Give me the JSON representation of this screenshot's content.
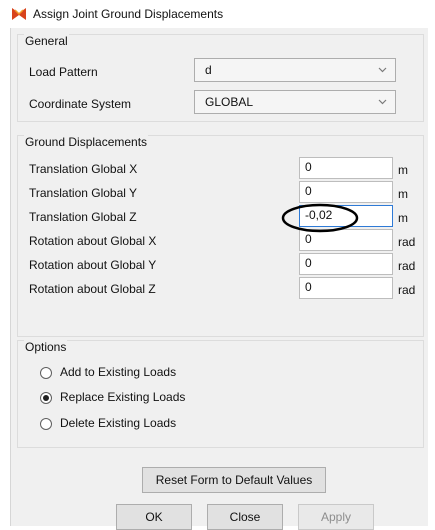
{
  "window": {
    "title": "Assign Joint Ground Displacements",
    "icon": "app-logo-icon"
  },
  "general": {
    "title": "General",
    "load_pattern": {
      "label": "Load Pattern",
      "value": "d"
    },
    "coordinate_system": {
      "label": "Coordinate System",
      "value": "GLOBAL"
    }
  },
  "ground_displacements": {
    "title": "Ground Displacements",
    "rows": [
      {
        "label": "Translation Global X",
        "value": "0",
        "unit": "m"
      },
      {
        "label": "Translation Global Y",
        "value": "0",
        "unit": "m"
      },
      {
        "label": "Translation Global Z",
        "value": "-0,02",
        "unit": "m"
      },
      {
        "label": "Rotation about Global X",
        "value": "0",
        "unit": "rad"
      },
      {
        "label": "Rotation about Global Y",
        "value": "0",
        "unit": "rad"
      },
      {
        "label": "Rotation about Global Z",
        "value": "0",
        "unit": "rad"
      }
    ]
  },
  "options": {
    "title": "Options",
    "radios": [
      {
        "label": "Add to Existing Loads",
        "checked": false
      },
      {
        "label": "Replace Existing Loads",
        "checked": true
      },
      {
        "label": "Delete Existing Loads",
        "checked": false
      }
    ]
  },
  "buttons": {
    "reset": "Reset Form to Default Values",
    "ok": "OK",
    "close": "Close",
    "apply": "Apply",
    "apply_enabled": false
  },
  "colors": {
    "dialog_bg": "#f0f0f0",
    "focus_border": "#2e7ad6",
    "annotation": "#000000"
  }
}
